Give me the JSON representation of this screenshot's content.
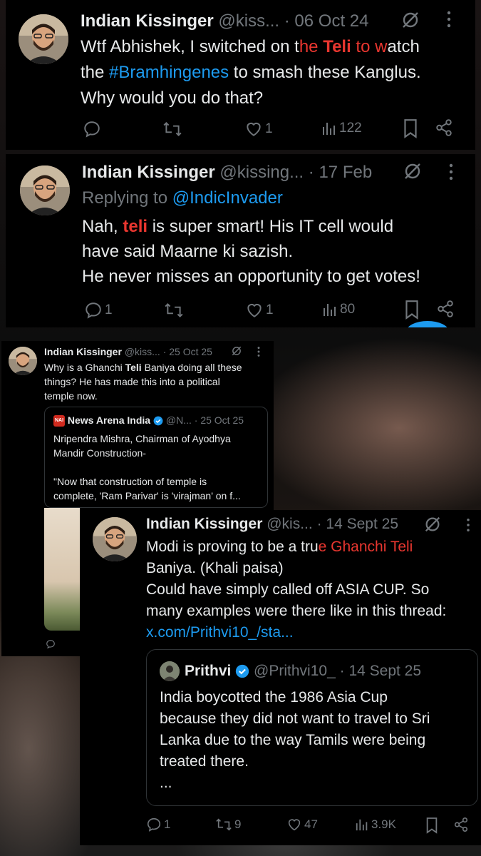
{
  "tweet1": {
    "name": "Indian Kissinger",
    "handle": "@kiss...",
    "sep": "·",
    "date": "06 Oct 24",
    "line1_a": "Wtf Abhishek, I switched on t",
    "line1_red": "he ",
    "line1_redb": "Teli",
    "line1_red2": " to w",
    "line1_b": "atch",
    "line2_a": "the ",
    "line2_tag": "#Bramhingenes",
    "line2_b": " to smash these Kanglus.",
    "line3": "Why would you do that?",
    "likes": "1",
    "views": "122"
  },
  "tweet2": {
    "name": "Indian Kissinger",
    "handle": "@kissing...",
    "sep": "·",
    "date": "17 Feb",
    "replying_label": "Replying to ",
    "replying_to": "@IndicInvader",
    "line1_a": "Nah, ",
    "line1_red": "teli ",
    "line1_b": "is super smart! His IT cell would",
    "line2": "have said Maarne ki sazish.",
    "line3": "He never misses an opportunity to get votes!",
    "replies": "1",
    "likes": "1",
    "views": "80"
  },
  "tweet3": {
    "name": "Indian Kissinger",
    "handle": "@kiss...",
    "sep": "·",
    "date": "25 Oct 25",
    "line1_a": "Why is a Ghanchi ",
    "line1_b": "Teli",
    "line1_c": " Baniya doing all these",
    "line2": "things? He has made this into a political",
    "line3": "temple now.",
    "quote": {
      "logo": "NAI",
      "name": "News Arena India",
      "handle": "@N...",
      "sep": "·",
      "date": "25 Oct 25",
      "line1": "Nripendra Mishra, Chairman of Ayodhya",
      "line2": "Mandir Construction-",
      "line3": "\"Now that construction of temple is",
      "line4": "complete, 'Ram Parivar' is 'virajman' on f..."
    }
  },
  "tweet4": {
    "name": "Indian Kissinger",
    "handle": "@kis...",
    "sep": "·",
    "date": "14 Sept 25",
    "line1_a": "Modi is proving to be a tru",
    "line1_red": "e Ghanchi ",
    "line1_redb": "Teli",
    "line2": "Baniya. (Khali paisa)",
    "line3": "Could have simply called off ASIA CUP. So",
    "line4": "many examples were there like in this thread:",
    "link": "x.com/Prithvi10_/sta...",
    "quote": {
      "name": "Prithvi",
      "handle": "@Prithvi10_",
      "sep": "·",
      "date": "14 Sept 25",
      "line1": "India boycotted the 1986 Asia Cup",
      "line2": "because they did not want to travel to Sri",
      "line3": "Lanka due to the way Tamils were being",
      "line4": "treated there.",
      "ellipsis": "..."
    },
    "replies": "1",
    "retweets": "9",
    "likes": "47",
    "views": "3.9K"
  },
  "colors": {
    "background": "#000000",
    "text": "#e7e9ea",
    "muted": "#71767b",
    "link": "#1d9bf0",
    "highlight": "#e8362f"
  },
  "icons": [
    "grok-icon",
    "more-icon",
    "reply-icon",
    "retweet-icon",
    "like-icon",
    "views-icon",
    "bookmark-icon",
    "share-icon",
    "verified-icon"
  ]
}
